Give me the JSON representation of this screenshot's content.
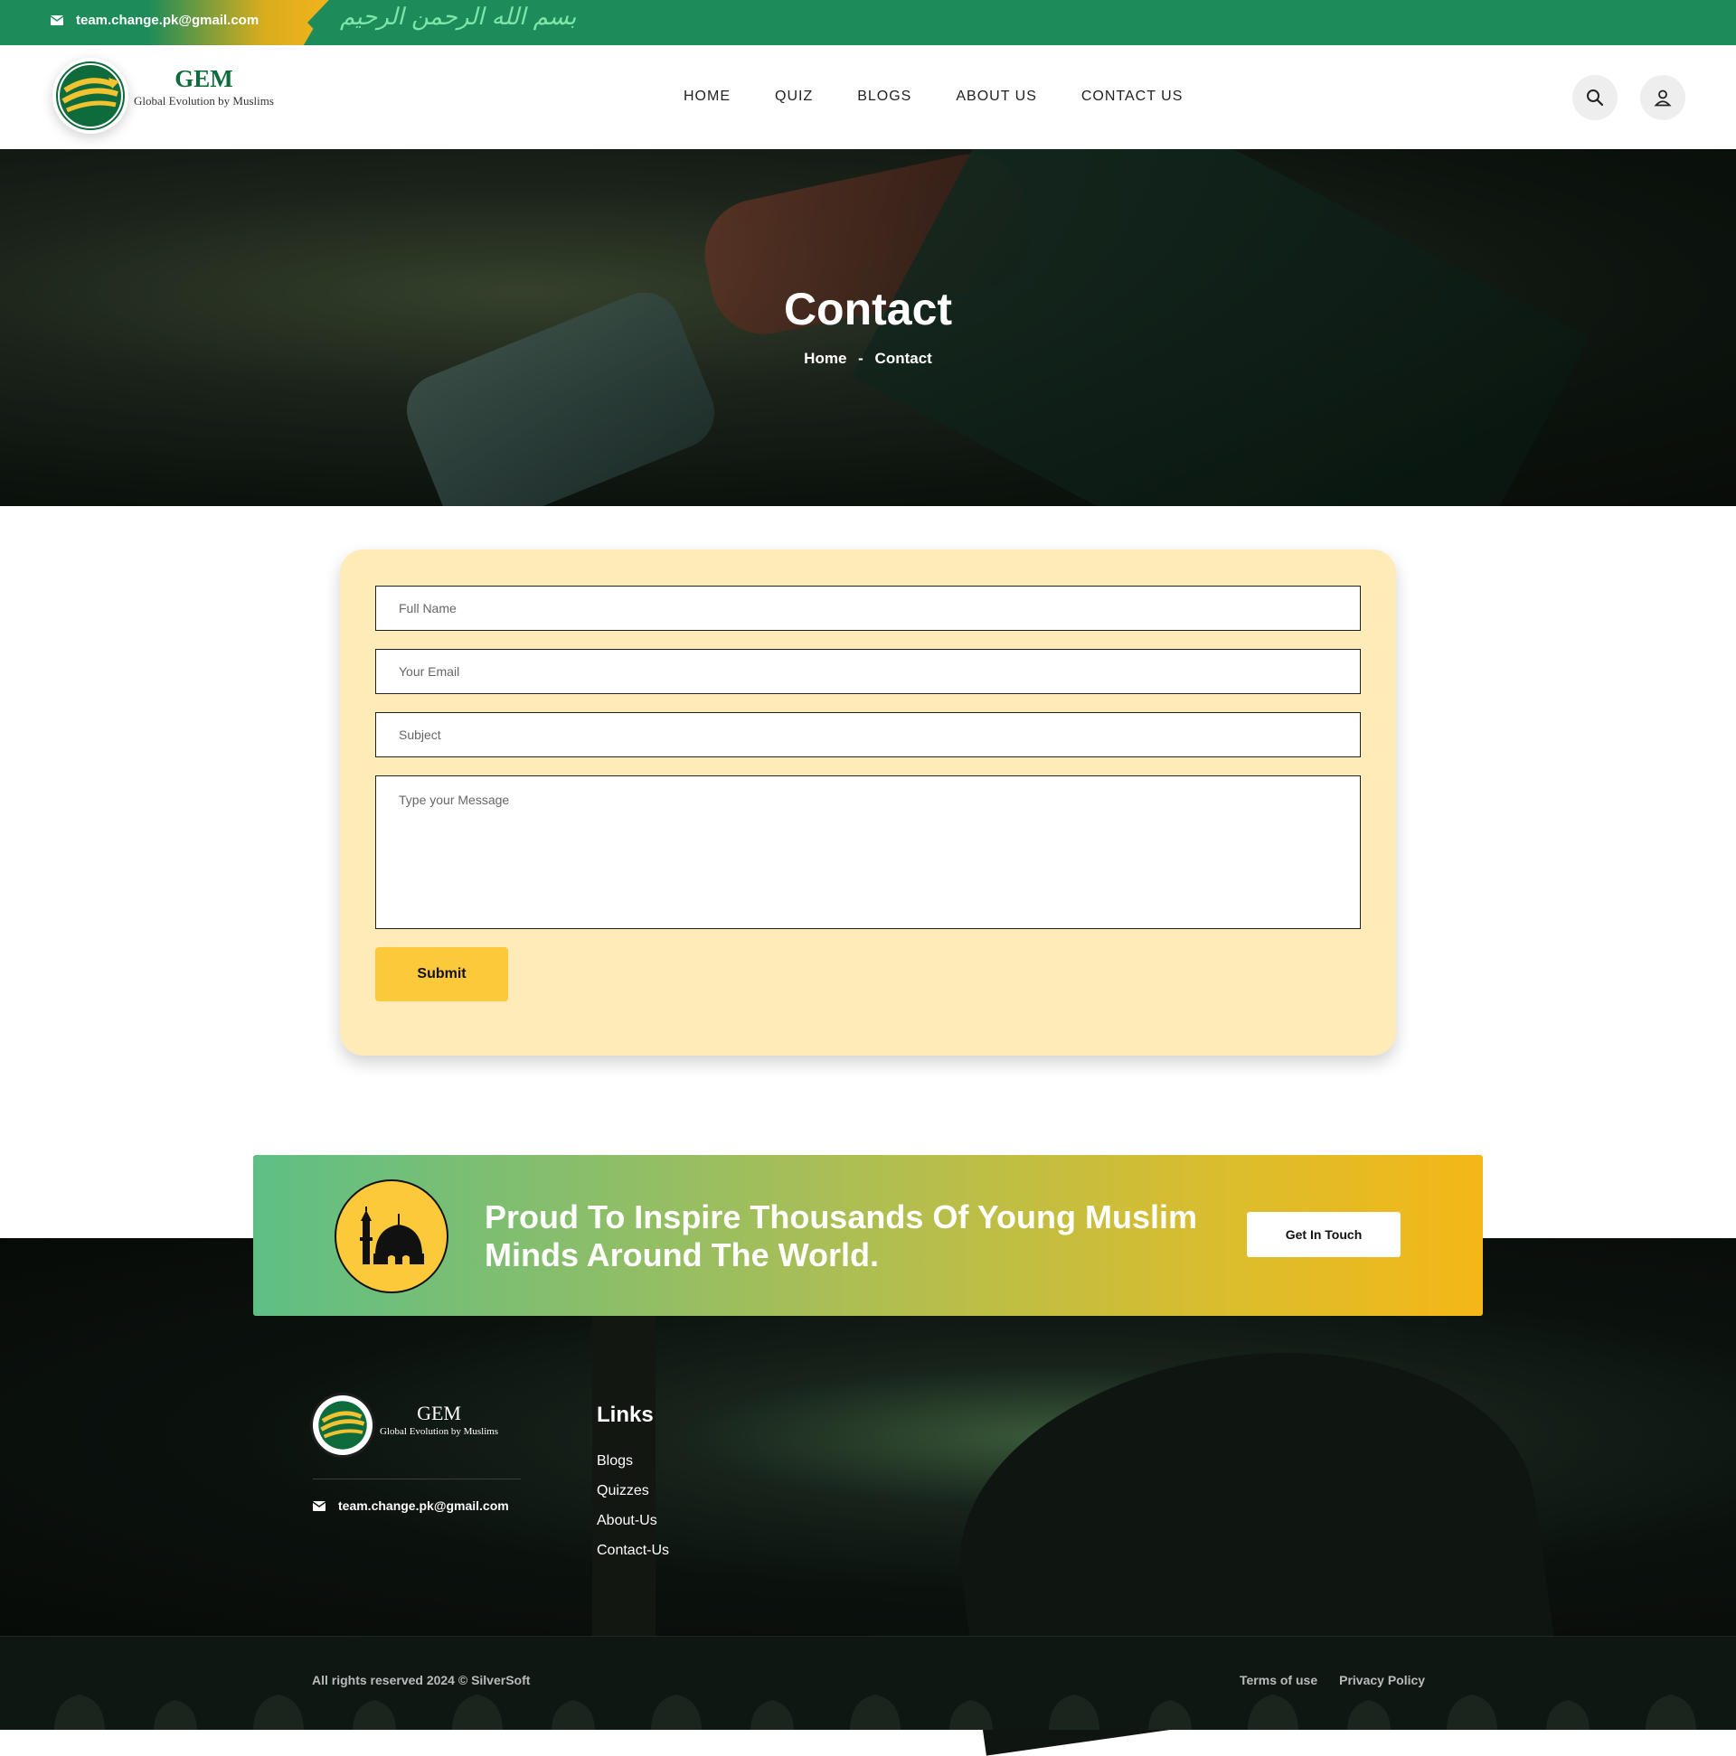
{
  "topbar": {
    "email": "team.change.pk@gmail.com",
    "calligraphy": "بسم الله الرحمن الرحيم"
  },
  "brand": {
    "name": "GEM",
    "tagline": "Global Evolution by Muslims",
    "colors": {
      "green": "#1e8c5a",
      "dark_green": "#0e6b3c",
      "gold": "#fcc93a",
      "cream": "#feebb8"
    }
  },
  "nav": {
    "items": [
      "HOME",
      "QUIZ",
      "BLOGS",
      "ABOUT US",
      "CONTACT US"
    ]
  },
  "header_icons": [
    "search-icon",
    "user-icon"
  ],
  "hero": {
    "title": "Contact",
    "breadcrumb": {
      "home": "Home",
      "separator": "-",
      "current": "Contact"
    }
  },
  "form": {
    "full_name_placeholder": "Full Name",
    "email_placeholder": "Your Email",
    "subject_placeholder": "Subject",
    "message_placeholder": "Type your Message",
    "submit_label": "Submit"
  },
  "cta": {
    "text": "Proud To Inspire Thousands Of Young Muslim Minds Around The World.",
    "button_label": "Get In Touch",
    "icon": "mosque-icon"
  },
  "footer": {
    "brand_name": "GEM",
    "brand_tagline": "Global Evolution by Muslims",
    "email": "team.change.pk@gmail.com",
    "links_title": "Links",
    "links": [
      "Blogs",
      "Quizzes",
      "About-Us",
      "Contact-Us"
    ],
    "copyright": "All rights reserved 2024 © SilverSoft",
    "terms": "Terms of use",
    "privacy": "Privacy Policy"
  }
}
